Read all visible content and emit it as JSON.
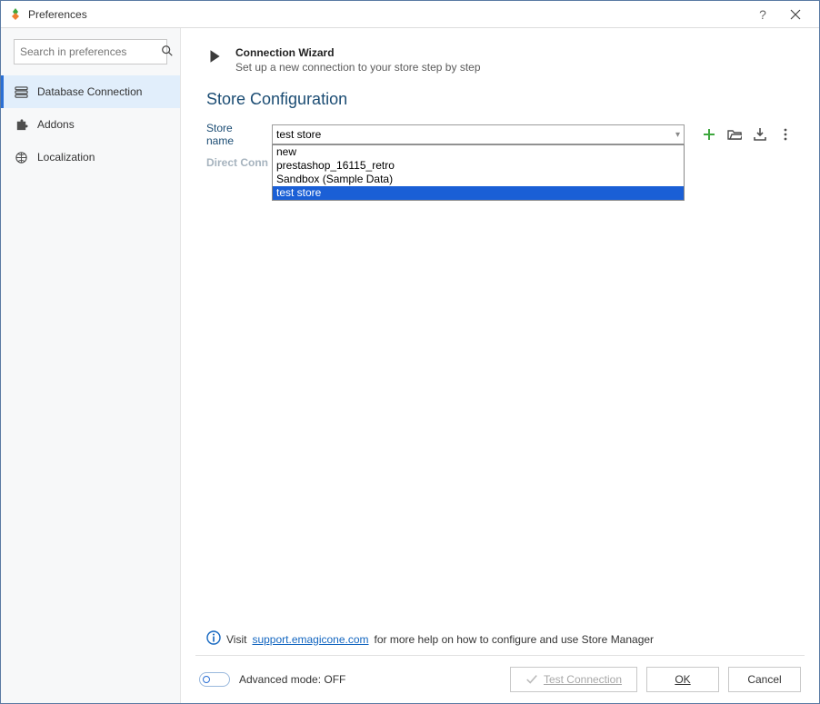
{
  "window": {
    "title": "Preferences"
  },
  "sidebar": {
    "search_placeholder": "Search in preferences",
    "items": [
      {
        "label": "Database Connection"
      },
      {
        "label": "Addons"
      },
      {
        "label": "Localization"
      }
    ]
  },
  "wizard": {
    "title": "Connection Wizard",
    "subtitle": "Set up a new connection to your store step by step"
  },
  "section": {
    "title": "Store Configuration"
  },
  "store": {
    "label": "Store name",
    "value": "test store",
    "options": [
      "new",
      "prestashop_16115_retro",
      "Sandbox (Sample Data)",
      "test store"
    ],
    "selected_index": 3
  },
  "direct_label": "Direct Conn",
  "info": {
    "prefix": "Visit ",
    "link": "support.emagicone.com",
    "suffix": " for more help on how to configure and use Store Manager"
  },
  "footer": {
    "advanced_label": "Advanced mode: OFF",
    "test_label": "Test Connection",
    "ok_label": "OK",
    "cancel_label": "Cancel"
  },
  "colors": {
    "accent": "#2a6fd4",
    "add": "#3ea73e"
  }
}
